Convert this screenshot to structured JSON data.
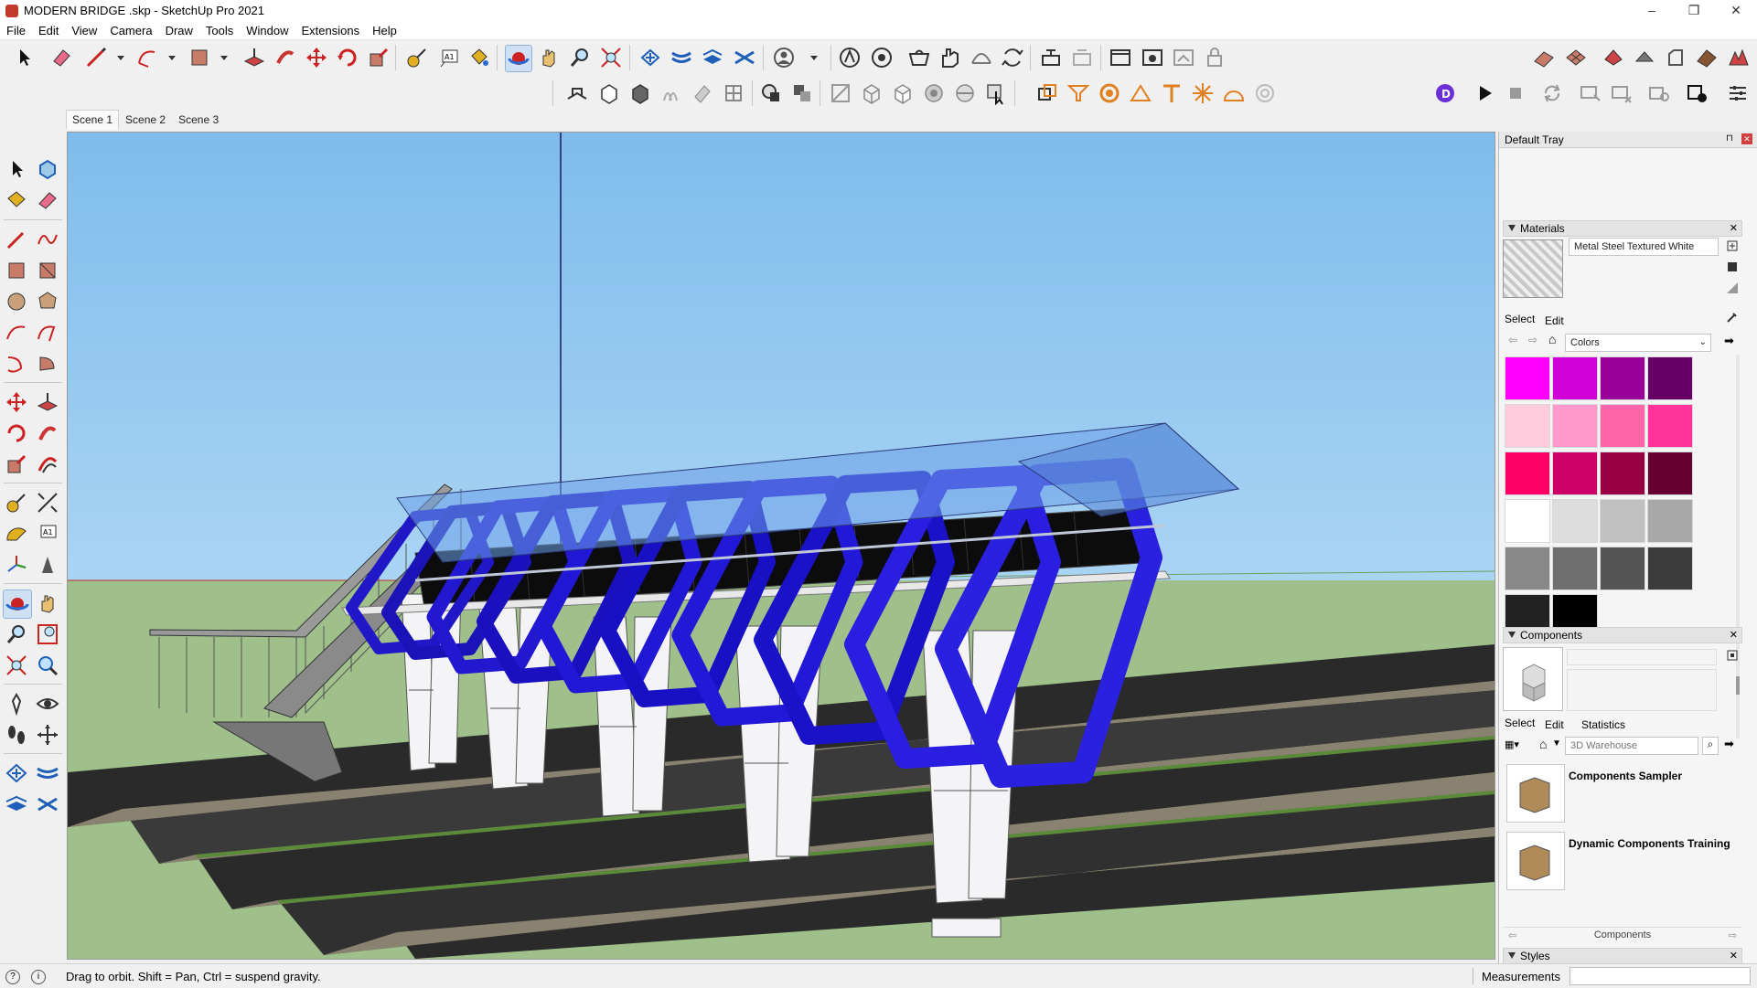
{
  "window": {
    "title": "MODERN BRIDGE .skp - SketchUp Pro 2021",
    "controls": [
      "–",
      "❐",
      "✕"
    ]
  },
  "menubar": [
    "File",
    "Edit",
    "View",
    "Camera",
    "Draw",
    "Tools",
    "Window",
    "Extensions",
    "Help"
  ],
  "scenes": {
    "tabs": [
      "Scene 1",
      "Scene 2",
      "Scene 3"
    ],
    "active": "Scene 1"
  },
  "tray": {
    "title": "Default Tray",
    "materials": {
      "header": "Materials",
      "current_material": "Metal Steel Textured White",
      "tab_select": "Select",
      "tab_edit": "Edit",
      "library": "Colors",
      "swatch_colors": [
        "#ff00ff",
        "#d000d8",
        "#990099",
        "#660066",
        "#ffccdd",
        "#ff99cc",
        "#ff66aa",
        "#ff3399",
        "#ff0066",
        "#cc0066",
        "#990044",
        "#660033",
        "#ffffff",
        "#dddddd",
        "#c0c0c0",
        "#a8a8a8",
        "#888888",
        "#6e6e6e",
        "#555555",
        "#3c3c3c",
        "#222222",
        "#000000"
      ]
    },
    "components": {
      "header": "Components",
      "tab_select": "Select",
      "tab_edit": "Edit",
      "tab_statistics": "Statistics",
      "search_placeholder": "3D Warehouse",
      "items": [
        "Components Sampler",
        "Dynamic Components Training"
      ],
      "footer": "Components"
    },
    "styles": {
      "header": "Styles"
    }
  },
  "status": {
    "hint": "Drag to orbit. Shift = Pan, Ctrl = suspend gravity.",
    "measurements_label": "Measurements",
    "measurements_value": ""
  }
}
